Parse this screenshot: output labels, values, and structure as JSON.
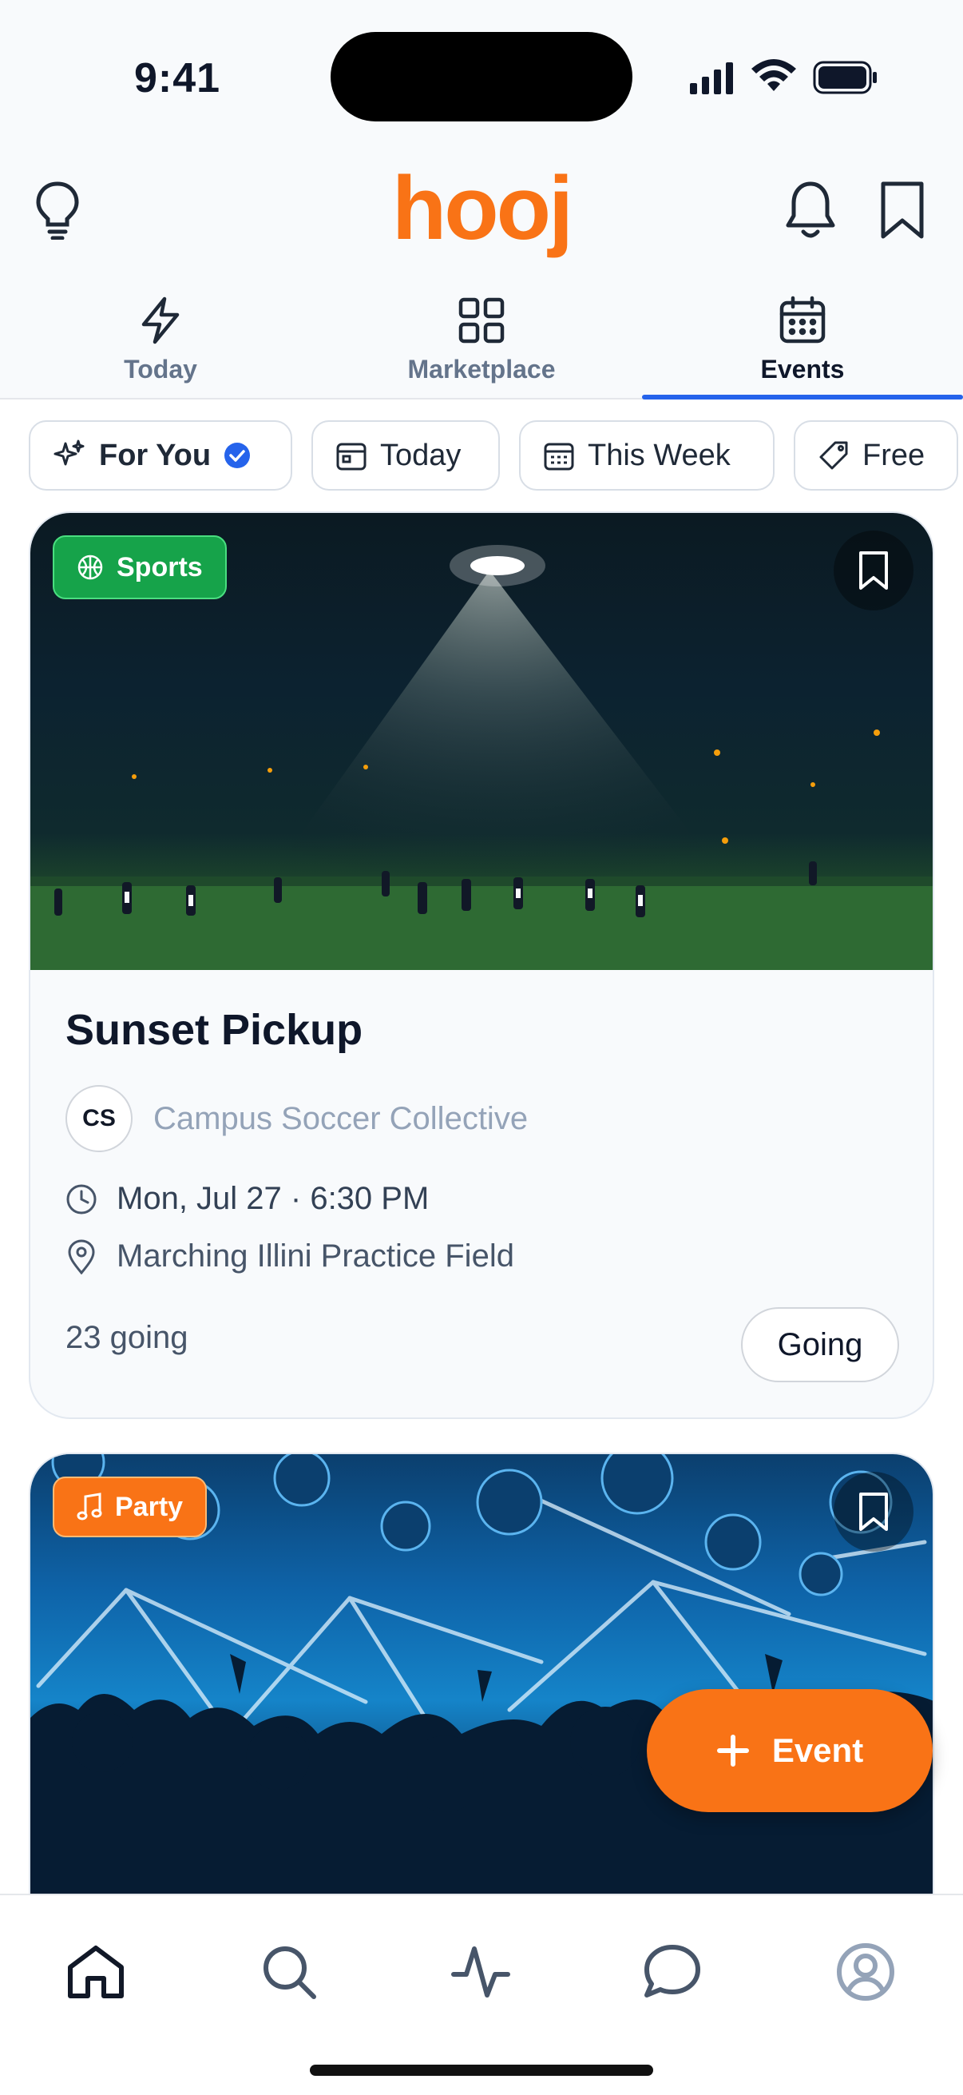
{
  "status_bar": {
    "time": "9:41"
  },
  "header": {
    "logo": "hooj"
  },
  "tabs": [
    {
      "label": "Today",
      "icon": "lightning-icon"
    },
    {
      "label": "Marketplace",
      "icon": "grid-icon"
    },
    {
      "label": "Events",
      "icon": "calendar-icon",
      "active": true
    }
  ],
  "filters": [
    {
      "label": "For You",
      "icon": "sparkles-icon",
      "selected": true
    },
    {
      "label": "Today",
      "icon": "calendar-day-icon"
    },
    {
      "label": "This Week",
      "icon": "calendar-week-icon"
    },
    {
      "label": "Free",
      "icon": "tag-icon"
    }
  ],
  "events": [
    {
      "category": "Sports",
      "category_color": "#16a34a",
      "title": "Sunset Pickup",
      "org_initials": "CS",
      "org_name": "Campus Soccer Collective",
      "datetime": "Mon, Jul 27 · 6:30 PM",
      "location": "Marching Illini Practice Field",
      "going_count": "23 going",
      "action": "Going"
    },
    {
      "category": "Party",
      "category_color": "#f97316"
    }
  ],
  "fab": {
    "label": "Event"
  },
  "bottom_nav": [
    "home-icon",
    "search-icon",
    "activity-icon",
    "chat-icon",
    "profile-icon"
  ],
  "colors": {
    "brand": "#f97316",
    "accent": "#2563eb",
    "sports": "#16a34a"
  }
}
